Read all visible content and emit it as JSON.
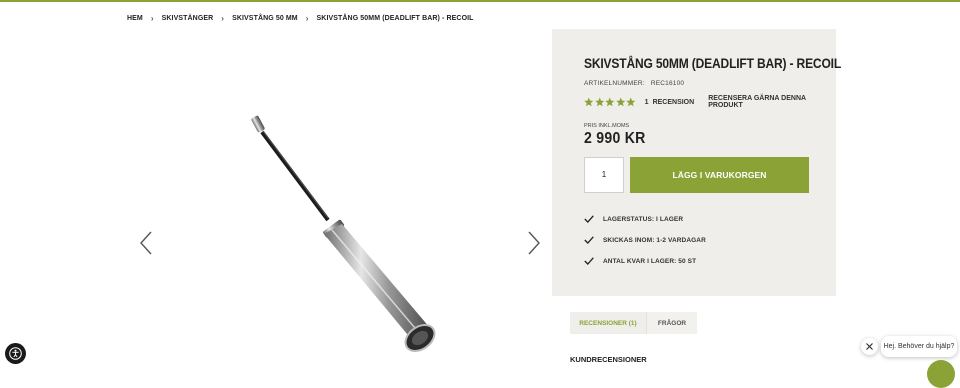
{
  "breadcrumb": {
    "items": [
      {
        "label": "HEM"
      },
      {
        "label": "SKIVSTÄNGER"
      },
      {
        "label": "SKIVSTÅNG 50 MM"
      },
      {
        "label": "SKIVSTÅNG 50MM (DEADLIFT BAR) - RECOIL"
      }
    ],
    "separator": "›"
  },
  "gallery": {
    "prev_icon": "chevron-left-icon",
    "next_icon": "chevron-right-icon"
  },
  "product": {
    "title": "SKIVSTÅNG 50MM (DEADLIFT BAR) - RECOIL",
    "sku_label": "ARTIKELNUMMER:",
    "sku_value": "REC16100",
    "rating": {
      "stars": 5,
      "count": "1",
      "count_label": "RECENSION",
      "write_review": "RECENSERA GÄRNA DENNA PRODUKT"
    },
    "price_label": "PRIS INKL.MOMS",
    "price": "2 990 KR",
    "quantity": "1",
    "add_to_cart": "LÄGG I VARUKORGEN",
    "features": [
      {
        "icon": "check-icon",
        "text": "LAGERSTATUS: I LAGER"
      },
      {
        "icon": "check-icon",
        "text": "SKICKAS INOM: 1-2 VARDAGAR"
      },
      {
        "icon": "check-icon",
        "text": "ANTAL KVAR I LAGER: 50 ST"
      }
    ]
  },
  "tabs": [
    {
      "label": "RECENSIONER (1)",
      "active": true
    },
    {
      "label": "FRÅGOR",
      "active": false
    }
  ],
  "reviews_heading": "KUNDRECENSIONER",
  "chat": {
    "message": "Hej. Behöver du hjälp?",
    "close_icon": "close-icon"
  },
  "accessibility_icon": "accessibility-icon",
  "colors": {
    "accent": "#8aa236",
    "panel_bg": "#efeeea",
    "text": "#222222"
  }
}
